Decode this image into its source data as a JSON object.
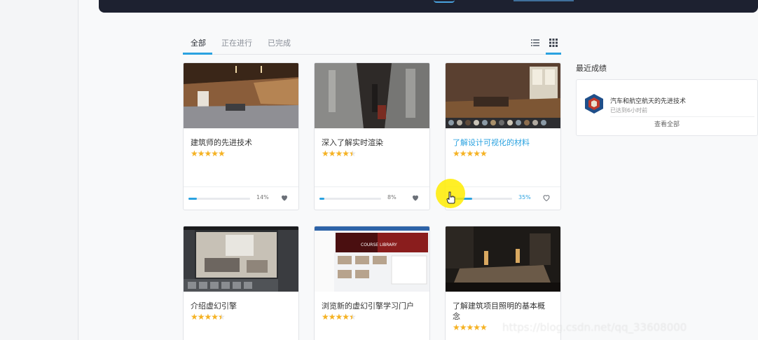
{
  "tabs": [
    {
      "label": "全部",
      "active": true
    },
    {
      "label": "正在进行",
      "active": false
    },
    {
      "label": "已完成",
      "active": false
    }
  ],
  "view_icons": [
    "list-view-icon",
    "grid-view-icon"
  ],
  "accent_color": "#2aa2e0",
  "star_color": "#f5b223",
  "courses": [
    {
      "title": "建筑师的先进技术",
      "stars": "★★★★★",
      "progress": 14,
      "progress_label": "14%",
      "favorited": true
    },
    {
      "title": "深入了解实时渲染",
      "stars": "★★★★",
      "half_star": true,
      "progress": 8,
      "progress_label": "8%",
      "favorited": true
    },
    {
      "title": "了解设计可视化的材料",
      "stars": "★★★★★",
      "progress": 35,
      "progress_label": "35%",
      "favorited": false
    },
    {
      "title": "介绍虚幻引擎",
      "stars": "★★★★",
      "half_star": true
    },
    {
      "title": "浏览新的虚幻引擎学习门户",
      "stars": "★★★★",
      "half_star": true
    },
    {
      "title": "了解建筑项目照明的基本概",
      "title_line2": "念",
      "stars": "★★★★★"
    }
  ],
  "thumb_texts": {
    "course_library": "COURSE LIBRARY"
  },
  "achievements": {
    "heading": "最近成绩",
    "item_name": "汽车和航空航天的先进技术",
    "item_time": "已达到6小时前",
    "view_all": "查看全部"
  },
  "watermark": "https://blog.csdn.net/qq_33608000"
}
